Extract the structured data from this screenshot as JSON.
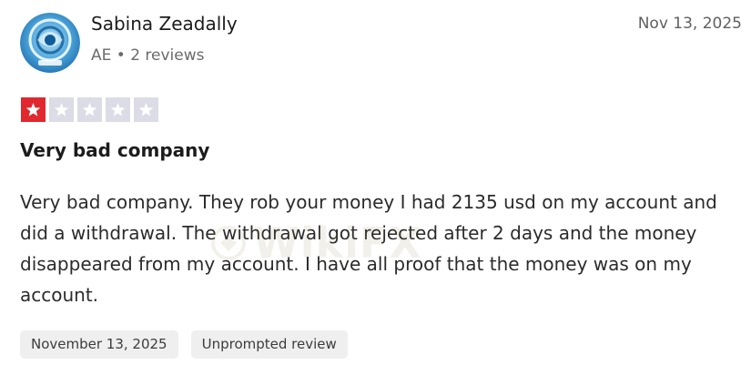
{
  "reviewer": {
    "name": "Sabina Zeadally",
    "meta": "AE • 2 reviews"
  },
  "review": {
    "date": "Nov 13, 2025",
    "rating": 1,
    "rating_max": 5,
    "title": "Very bad company",
    "body": "Very bad company. They rob your money I had 2135 usd on my account and did a withdrawal. The withdrawal got rejected after 2 days and the money disappeared from my account. I have all proof that the money was on my account."
  },
  "tags": [
    "November 13, 2025",
    "Unprompted review"
  ],
  "watermark": {
    "text": "WikiFX"
  },
  "colors": {
    "star_filled": "#e0282e",
    "star_empty": "#dcdce6",
    "tag_background": "#efefef",
    "avatar_primary": "#2f86c9"
  }
}
